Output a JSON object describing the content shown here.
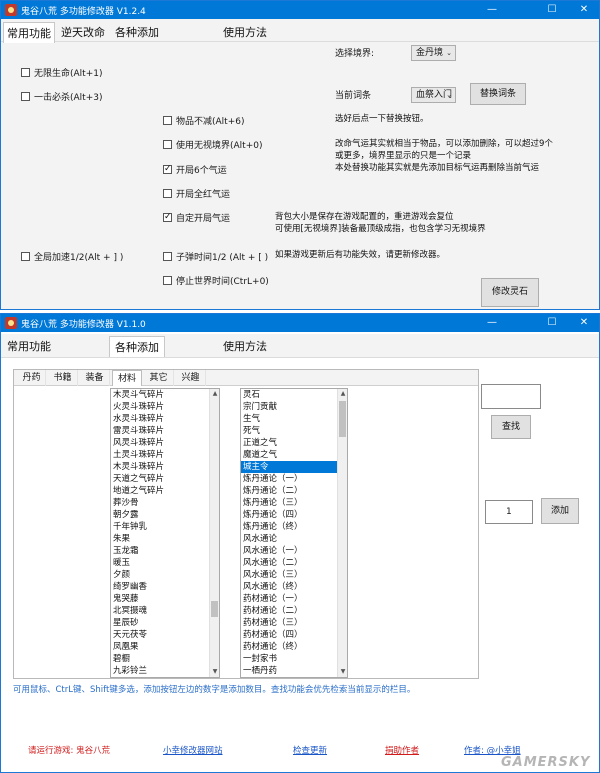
{
  "colors": {
    "titlebar": "#0078d7",
    "selection": "#0078d7",
    "info_blue": "#2a6ec9",
    "link_blue": "#1a55c8",
    "link_red": "#d11a1a"
  },
  "window1": {
    "title": "鬼谷八荒 多功能修改器  V1.2.4",
    "controls": {
      "minimize": "—",
      "maximize": "☐",
      "close": "✕"
    },
    "tabs": [
      "常用功能",
      "逆天改命",
      "各种添加",
      "使用方法"
    ],
    "checkboxes": [
      {
        "label": "无限生命(Alt+1)",
        "checked": false
      },
      {
        "label": "一击必杀(Alt+3)",
        "checked": false
      },
      {
        "label": "物品不减(Alt+6)",
        "checked": false
      },
      {
        "label": "使用无视境界(Alt+0)",
        "checked": false
      },
      {
        "label": "开局6个气运",
        "checked": true
      },
      {
        "label": "开局全红气运",
        "checked": false
      },
      {
        "label": "自定开局气运",
        "checked": true
      },
      {
        "label": "全局加速1/2(Alt + ] )",
        "checked": false
      },
      {
        "label": "子弹时间1/2 (Alt + [ )",
        "checked": false
      },
      {
        "label": "停止世界时间(CtrL+0)",
        "checked": false
      }
    ],
    "realm_label": "选择境界:",
    "realm_value": "金丹境",
    "entry_label": "当前词条",
    "entry_value": "血祭入门",
    "replace_button": "替换词条",
    "replace_tip": "选好后点一下替换按钮。",
    "notes": [
      "改命气运其实就相当于物品，可以添加删除，可以超过9个",
      "或更多，境界里显示的只是一个记录",
      "本处替换功能其实就是先添加目标气运再删除当前气运",
      "背包大小是保存在游戏配置的，重进游戏会复位",
      "可使用[无视境界]装备最顶级成指，也包含学习无视境界",
      "如果游戏更新后有功能失效，请更新修改器。"
    ],
    "modify_button": "修改灵石"
  },
  "window2": {
    "title": "鬼谷八荒 多功能修改器  V1.1.0",
    "controls": {
      "minimize": "—",
      "maximize": "☐",
      "close": "✕"
    },
    "tabs": [
      "常用功能",
      "各种添加",
      "使用方法"
    ],
    "subtabs": [
      "丹药",
      "书籍",
      "装备",
      "材料",
      "其它",
      "兴趣"
    ],
    "materials": [
      "木灵斗气碎片",
      "火灵斗珠碎片",
      "水灵斗珠碎片",
      "雷灵斗珠碎片",
      "风灵斗珠碎片",
      "土灵斗珠碎片",
      "木灵斗珠碎片",
      "天道之气碎片",
      "地道之气碎片",
      "葬沙骨",
      "朝夕露",
      "千年钟乳",
      "朱果",
      "玉龙霜",
      "暖玉",
      "夕颜",
      "绮罗幽香",
      "鬼哭藤",
      "北冥摄魂",
      "星辰砂",
      "天元茯苓",
      "凤凰果",
      "碧橱",
      "九彩铃兰"
    ],
    "items": [
      "灵石",
      "宗门贡献",
      "生气",
      "死气",
      "正道之气",
      "魔道之气",
      "城主令",
      "炼丹通论（一）",
      "炼丹通论（二）",
      "炼丹通论（三）",
      "炼丹通论（四）",
      "炼丹通论（终）",
      "风水通论",
      "风水通论（一）",
      "风水通论（二）",
      "风水通论（三）",
      "风水通论（终）",
      "药材通论（一）",
      "药材通论（二）",
      "药材通论（三）",
      "药材通论（四）",
      "药材通论（终）",
      "一封家书",
      "一栖丹药"
    ],
    "selected_item": "城主令",
    "search_value": "",
    "search_button": "查找",
    "quantity": "1",
    "add_button": "添加",
    "help_text": "可用鼠标、CtrL键、Shift键多选，添加按钮左边的数字是添加数目。查找功能会优先检索当前显示的栏目。",
    "footer": {
      "run_game": "请运行游戏: 鬼谷八荒",
      "site": "小幸修改器网站",
      "update": "检查更新",
      "donate": "捐助作者",
      "author": "作者: @小幸姐"
    },
    "watermark": "GAMERSKY"
  }
}
